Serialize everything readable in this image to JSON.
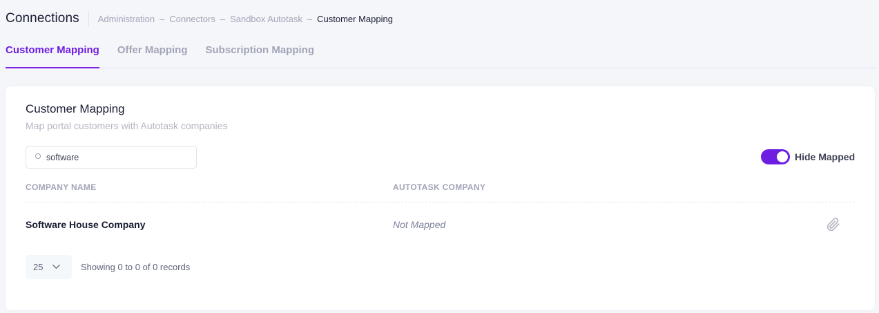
{
  "header": {
    "title": "Connections",
    "breadcrumb": [
      "Administration",
      "Connectors",
      "Sandbox Autotask",
      "Customer Mapping"
    ],
    "separator": "–"
  },
  "tabs": [
    {
      "label": "Customer Mapping",
      "active": true
    },
    {
      "label": "Offer Mapping",
      "active": false
    },
    {
      "label": "Subscription Mapping",
      "active": false
    }
  ],
  "card": {
    "title": "Customer Mapping",
    "subtitle": "Map portal customers with Autotask companies",
    "search": {
      "value": "software",
      "icon": "search-icon"
    },
    "toggle": {
      "label": "Hide Mapped",
      "on": true
    },
    "table": {
      "columns": [
        "Company Name",
        "Autotask Company"
      ],
      "rows": [
        {
          "company_name": "Software House Company",
          "autotask_company": "Not Mapped",
          "action_icon": "paperclip-icon"
        }
      ]
    },
    "pagination": {
      "page_size": "25",
      "info": "Showing 0 to 0 of 0 records"
    }
  },
  "colors": {
    "accent": "#6e1ee0",
    "muted": "#a1a5b7",
    "text": "#181c32"
  }
}
